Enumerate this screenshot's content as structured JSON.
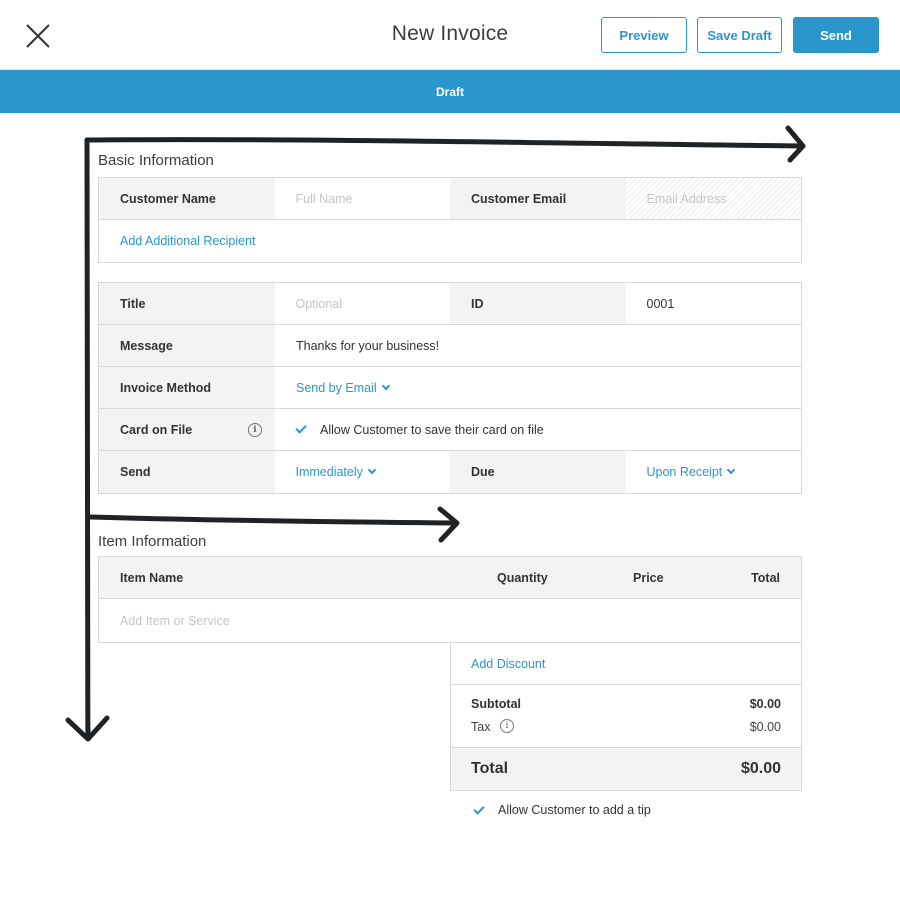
{
  "header": {
    "title": "New Invoice",
    "preview_label": "Preview",
    "save_draft_label": "Save Draft",
    "send_label": "Send"
  },
  "status": "Draft",
  "basic": {
    "title": "Basic Information",
    "customer_name_label": "Customer Name",
    "customer_name_placeholder": "Full Name",
    "customer_email_label": "Customer Email",
    "customer_email_placeholder": "Email Address",
    "add_recipient": "Add Additional Recipient"
  },
  "details": {
    "title_label": "Title",
    "title_placeholder": "Optional",
    "id_label": "ID",
    "id_value": "0001",
    "message_label": "Message",
    "message_value": "Thanks for your business!",
    "method_label": "Invoice Method",
    "method_value": "Send by Email",
    "card_label": "Card on File",
    "card_option": "Allow Customer to save their card on file",
    "send_label": "Send",
    "send_value": "Immediately",
    "due_label": "Due",
    "due_value": "Upon Receipt"
  },
  "items": {
    "title": "Item Information",
    "col_name": "Item Name",
    "col_quantity": "Quantity",
    "col_price": "Price",
    "col_total": "Total",
    "add_placeholder": "Add Item or Service"
  },
  "totals": {
    "add_discount": "Add Discount",
    "subtotal_label": "Subtotal",
    "subtotal_value": "$0.00",
    "tax_label": "Tax",
    "tax_value": "$0.00",
    "total_label": "Total",
    "total_value": "$0.00"
  },
  "tip_option": "Allow Customer to add a tip",
  "colors": {
    "accent": "#2b96cc",
    "label_bg": "#f2f3f4",
    "border": "#d9d9d9",
    "annotation": "#1f2326"
  },
  "icons": [
    "close-icon",
    "info-icon",
    "chevron-down-icon",
    "checkmark-icon"
  ]
}
